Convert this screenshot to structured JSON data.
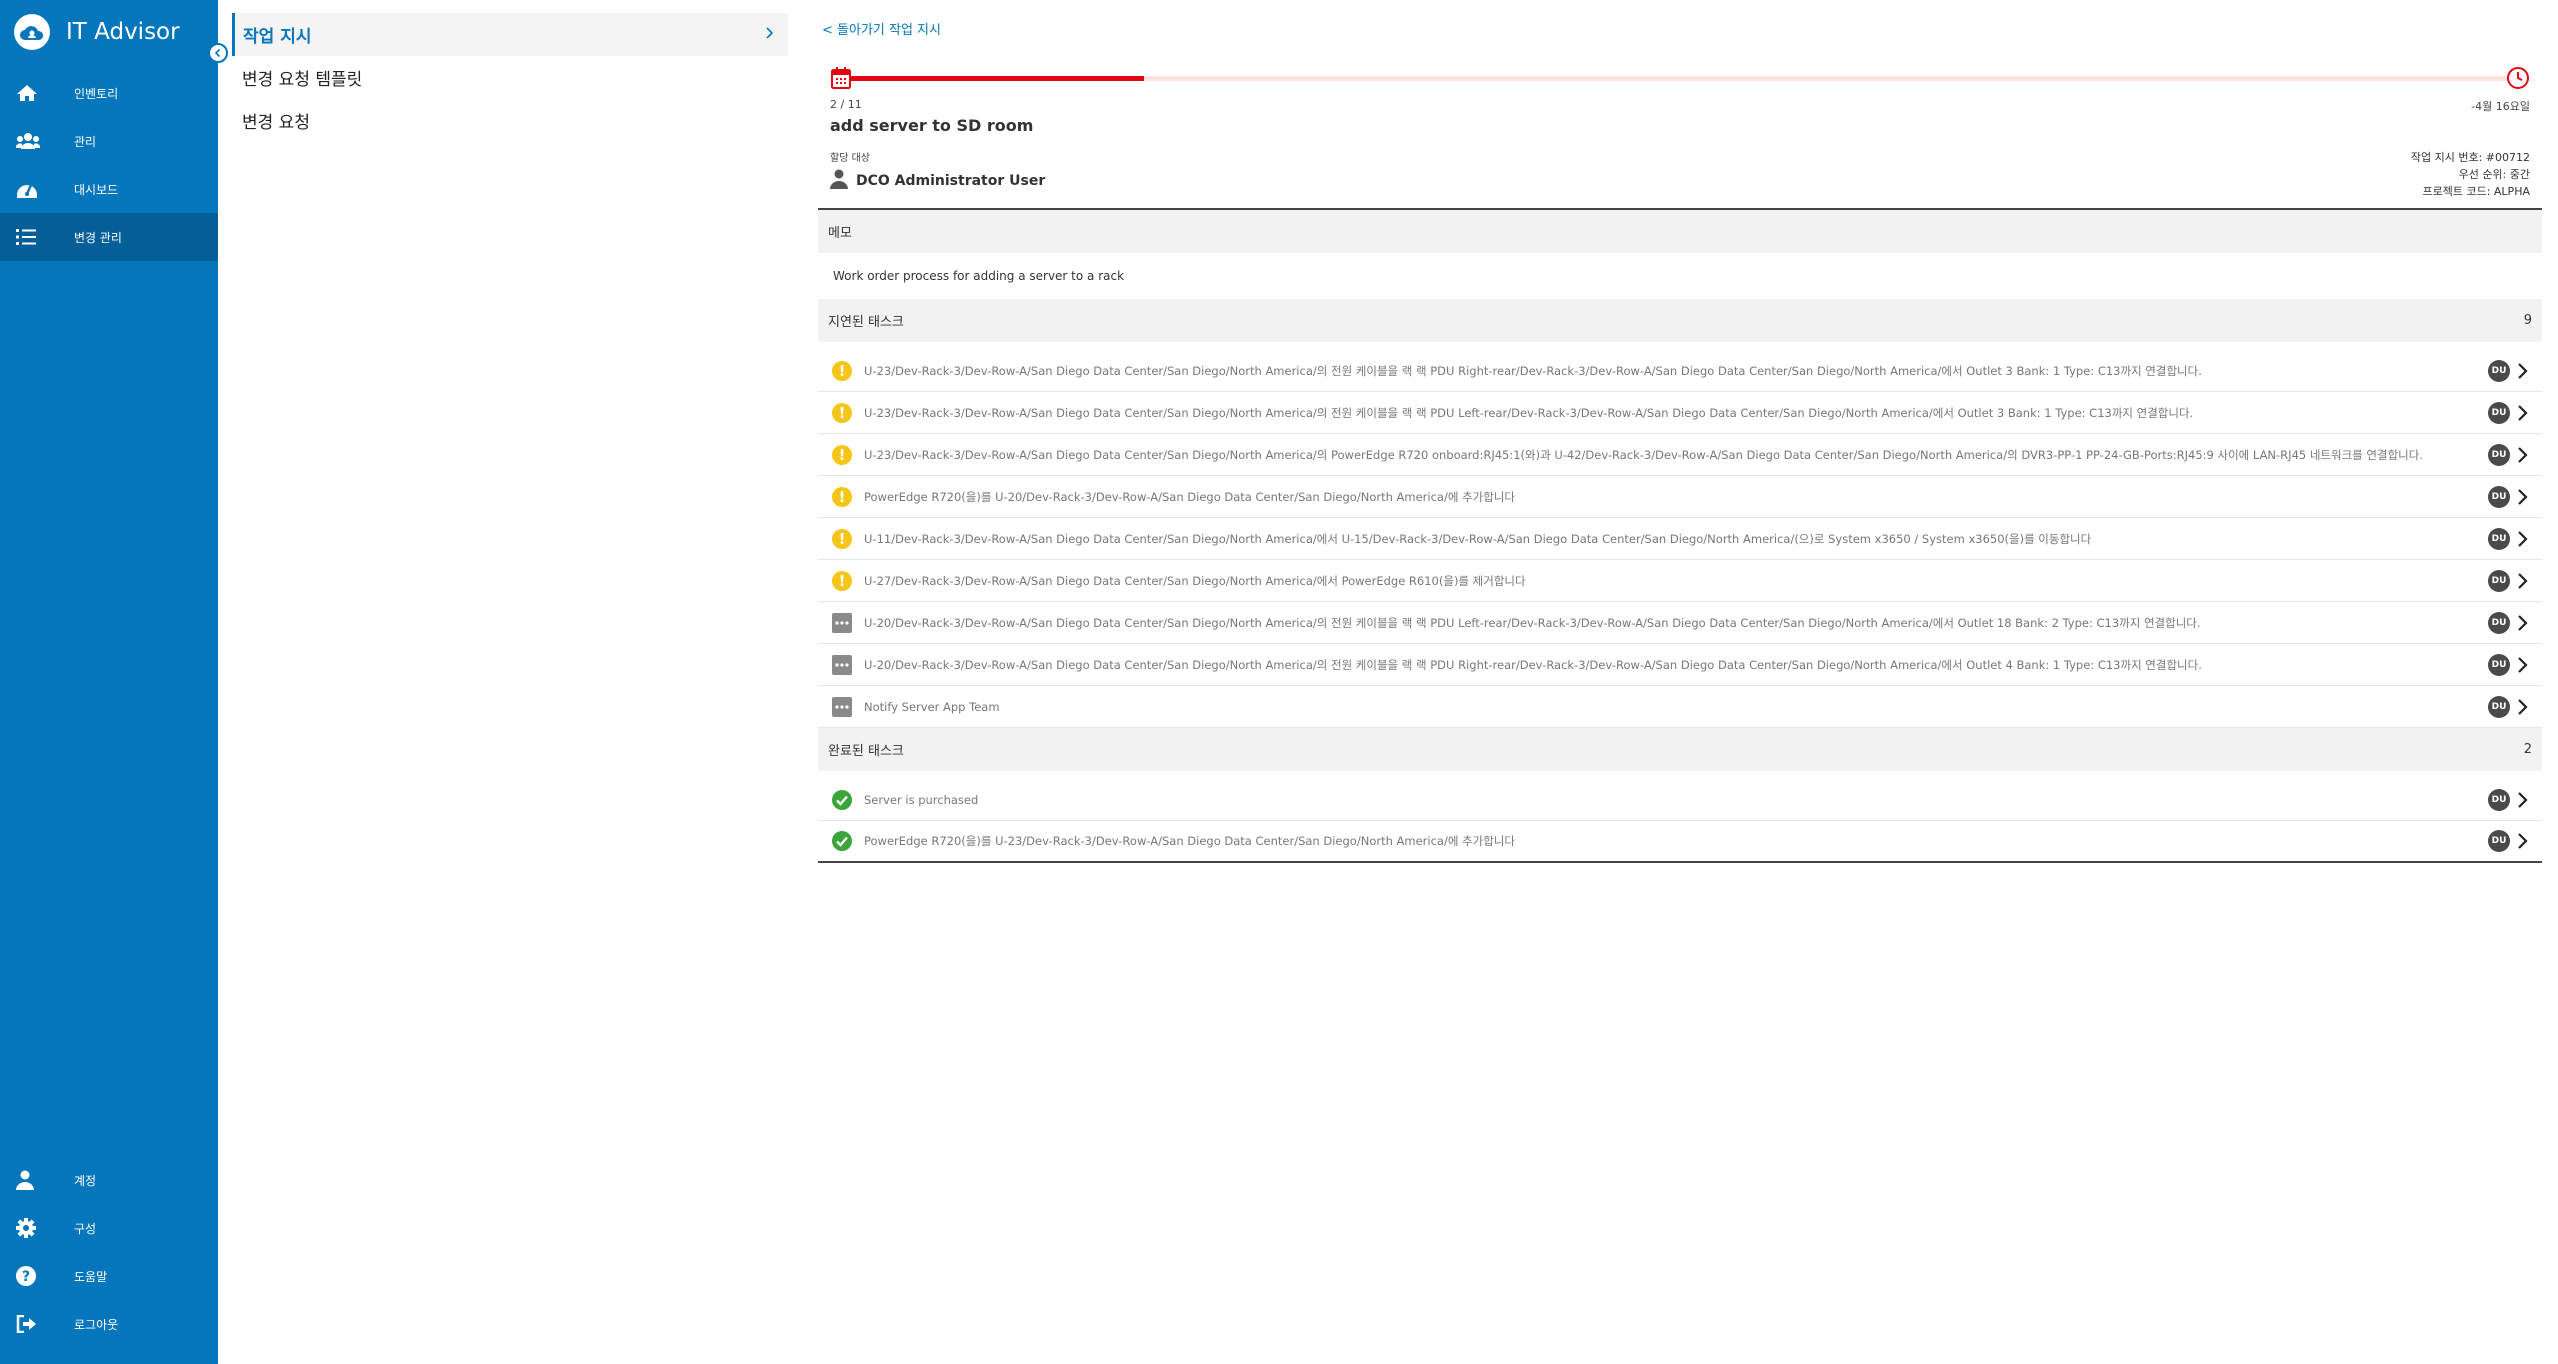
{
  "app": {
    "title": "IT Advisor"
  },
  "nav": {
    "items": [
      {
        "label": "인벤토리",
        "icon": "home-icon",
        "active": false
      },
      {
        "label": "관리",
        "icon": "users-icon",
        "active": false
      },
      {
        "label": "대시보드",
        "icon": "dashboard-icon",
        "active": false
      },
      {
        "label": "변경 관리",
        "icon": "list-icon",
        "active": true
      }
    ],
    "bottom": [
      {
        "label": "계정",
        "icon": "user-icon"
      },
      {
        "label": "구성",
        "icon": "gear-icon"
      },
      {
        "label": "도움말",
        "icon": "help-icon"
      },
      {
        "label": "로그아웃",
        "icon": "logout-icon"
      }
    ]
  },
  "subnav": {
    "items": [
      {
        "label": "작업 지시",
        "active": true
      },
      {
        "label": "변경 요청 템플릿",
        "active": false
      },
      {
        "label": "변경 요청",
        "active": false
      }
    ]
  },
  "work_order": {
    "back_label": "< 돌아가기 작업 지시",
    "progress_label": "2 / 11",
    "progress_fraction": 0.18,
    "due_label": "-4월 16요일",
    "title": "add server to SD room",
    "assigned_label": "할당 대상",
    "assignee": "DCO Administrator User",
    "meta": {
      "number": "작업 지시 번호: #00712",
      "priority": "우선 순위: 중간",
      "project": "프로젝트 코드: ALPHA"
    },
    "memo_header": "메모",
    "memo_text": "Work order process for adding a server to a rack",
    "overdue": {
      "header": "지연된 태스크",
      "count": "9",
      "tasks": [
        {
          "status": "warning",
          "text": "U-23/Dev-Rack-3/Dev-Row-A/San Diego Data Center/San Diego/North America/의 전원 케이블을 랙 랙 PDU Right-rear/Dev-Rack-3/Dev-Row-A/San Diego Data Center/San Diego/North America/에서 Outlet 3 Bank: 1 Type: C13까지 연결합니다.",
          "assignee": "DU"
        },
        {
          "status": "warning",
          "text": "U-23/Dev-Rack-3/Dev-Row-A/San Diego Data Center/San Diego/North America/의 전원 케이블을 랙 랙 PDU Left-rear/Dev-Rack-3/Dev-Row-A/San Diego Data Center/San Diego/North America/에서 Outlet 3 Bank: 1 Type: C13까지 연결합니다.",
          "assignee": "DU"
        },
        {
          "status": "warning",
          "text": "U-23/Dev-Rack-3/Dev-Row-A/San Diego Data Center/San Diego/North America/의 PowerEdge R720 onboard:RJ45:1(와)과 U-42/Dev-Rack-3/Dev-Row-A/San Diego Data Center/San Diego/North America/의 DVR3-PP-1 PP-24-GB-Ports:RJ45:9 사이에 LAN-RJ45 네트워크를 연결합니다.",
          "assignee": "DU"
        },
        {
          "status": "warning",
          "text": "PowerEdge R720(을)를 U-20/Dev-Rack-3/Dev-Row-A/San Diego Data Center/San Diego/North America/에 추가합니다",
          "assignee": "DU"
        },
        {
          "status": "warning",
          "text": "U-11/Dev-Rack-3/Dev-Row-A/San Diego Data Center/San Diego/North America/에서 U-15/Dev-Rack-3/Dev-Row-A/San Diego Data Center/San Diego/North America/(으)로 System x3650 / System x3650(을)를 이동합니다",
          "assignee": "DU"
        },
        {
          "status": "warning",
          "text": "U-27/Dev-Rack-3/Dev-Row-A/San Diego Data Center/San Diego/North America/에서 PowerEdge R610(을)를 제거합니다",
          "assignee": "DU"
        },
        {
          "status": "pending",
          "text": "U-20/Dev-Rack-3/Dev-Row-A/San Diego Data Center/San Diego/North America/의 전원 케이블을 랙 랙 PDU Left-rear/Dev-Rack-3/Dev-Row-A/San Diego Data Center/San Diego/North America/에서 Outlet 18 Bank: 2 Type: C13까지 연결합니다.",
          "assignee": "DU"
        },
        {
          "status": "pending",
          "text": "U-20/Dev-Rack-3/Dev-Row-A/San Diego Data Center/San Diego/North America/의 전원 케이블을 랙 랙 PDU Right-rear/Dev-Rack-3/Dev-Row-A/San Diego Data Center/San Diego/North America/에서 Outlet 4 Bank: 1 Type: C13까지 연결합니다.",
          "assignee": "DU"
        },
        {
          "status": "pending",
          "text": "Notify Server App Team",
          "assignee": "DU"
        }
      ]
    },
    "completed": {
      "header": "완료된 태스크",
      "count": "2",
      "tasks": [
        {
          "status": "done",
          "text": "Server is purchased",
          "assignee": "DU"
        },
        {
          "status": "done",
          "text": "PowerEdge R720(을)를 U-23/Dev-Rack-3/Dev-Row-A/San Diego Data Center/San Diego/North America/에 추가합니다",
          "assignee": "DU"
        }
      ]
    }
  },
  "colors": {
    "nav_bg": "#0576bb",
    "nav_active": "#045f98",
    "progress": "#e30613",
    "warning": "#f5c518",
    "done": "#3aa53a"
  }
}
